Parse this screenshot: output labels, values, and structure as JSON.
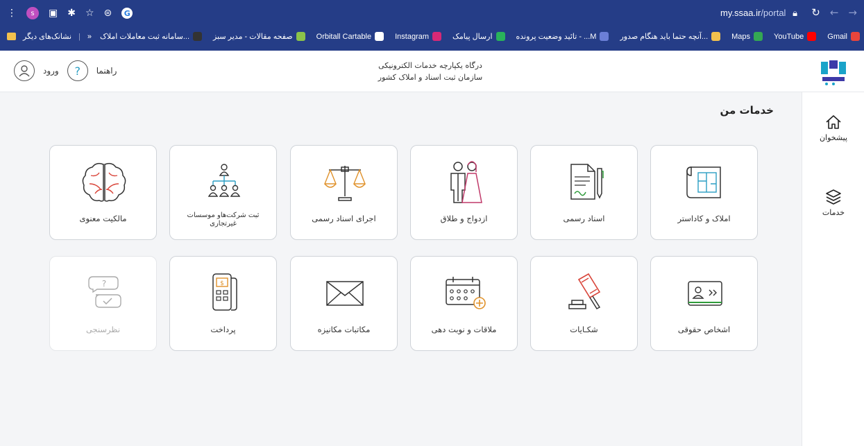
{
  "browser": {
    "profile_initial": "s",
    "url_host": "my.ssaa.ir",
    "url_path": "/portal",
    "bookmarks": [
      {
        "label": "Gmail",
        "color": "#e8453c"
      },
      {
        "label": "YouTube",
        "color": "#ff0000"
      },
      {
        "label": "Maps",
        "color": "#34a853"
      },
      {
        "label": "آنچه حتما باید هنگام صدور...",
        "color": "#f2c14e"
      },
      {
        "label": "تائید وضعیت پرونده - ...M",
        "color": "#6b7fd7"
      },
      {
        "label": "ارسال پیامک",
        "color": "#29b35b"
      },
      {
        "label": "Instagram",
        "color": "#d62976"
      },
      {
        "label": "Orbitall Cartable",
        "color": "#ffffff"
      },
      {
        "label": "صفحه مقالات - مدیر سبز",
        "color": "#8bc34a"
      },
      {
        "label": "سامانه ثبت معاملات املاک...",
        "color": "#333333"
      }
    ],
    "other_bookmarks": "نشانک‌های دیگر",
    "overflow": "»"
  },
  "header": {
    "portal_line1": "درگاه یکپارچه خدمات الکترونیکی",
    "portal_line2": "سازمان ثبت اسناد و املاک کشور",
    "login_label": "ورود",
    "help_label": "راهنما",
    "help_glyph": "?"
  },
  "sidebar": {
    "items": [
      {
        "label": "پیشخوان",
        "icon": "home-icon"
      },
      {
        "label": "خدمات",
        "icon": "layers-icon"
      }
    ]
  },
  "main": {
    "title": "خدمات من",
    "row1": [
      {
        "label": "املاک و کاداستر",
        "icon": "cadastre-map-icon"
      },
      {
        "label": "اسناد رسمی",
        "icon": "document-pen-icon"
      },
      {
        "label": "ازدواج و طلاق",
        "icon": "couple-icon"
      },
      {
        "label": "اجرای اسناد رسمی",
        "icon": "scales-icon"
      },
      {
        "label": "ثبت شرکت‌هاو موسسات غیرتجاری",
        "icon": "org-chart-icon"
      },
      {
        "label": "مالکیت معنوی",
        "icon": "brain-icon"
      }
    ],
    "row2": [
      {
        "label": "اشخاص حقوقی",
        "icon": "id-card-icon"
      },
      {
        "label": "شکـایات",
        "icon": "gavel-icon"
      },
      {
        "label": "ملاقات و نوبت دهی",
        "icon": "calendar-icon"
      },
      {
        "label": "مکاتبات مکانیزه",
        "icon": "envelope-icon"
      },
      {
        "label": "پرداخت",
        "icon": "pos-terminal-icon"
      },
      {
        "label": "نظرسنجی",
        "icon": "survey-icon"
      }
    ]
  }
}
